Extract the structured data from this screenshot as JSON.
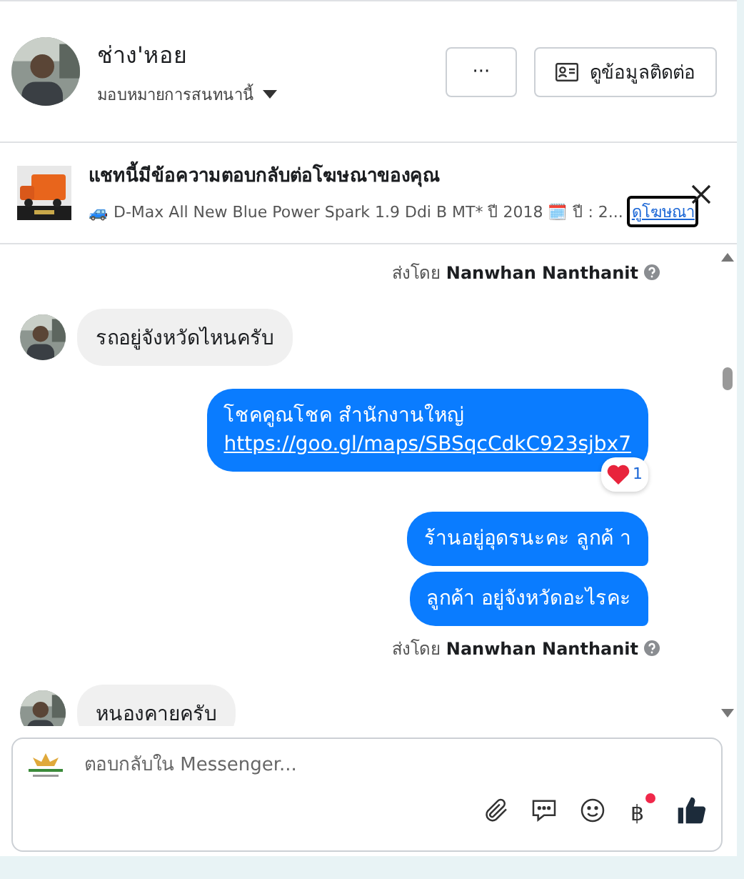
{
  "header": {
    "name": "ช่าง'หอย",
    "assign_label": "มอบหมายการสนทนานี้",
    "more_button": "···",
    "contact_button": "ดูข้อมูลติดต่อ"
  },
  "ad_banner": {
    "title": "แชทนี้มีข้อความตอบกลับต่อโฆษณาของคุณ",
    "description": "🚙 D-Max All New Blue Power Spark 1.9 Ddi B MT* ปี 2018 🗓️ ปี : 2...",
    "link": "ดูโฆษณา"
  },
  "messages": [
    {
      "kind": "sent_by",
      "prefix": "ส่งโดย",
      "sender": "Nanwhan Nanthanit"
    },
    {
      "kind": "incoming",
      "text": "รถอยู่จังหวัดไหนครับ"
    },
    {
      "kind": "outgoing",
      "text": "โชคคูณโชค สำนักงานใหญ่",
      "link": "https://goo.gl/maps/SBSqcCdkC923sjbx7",
      "reaction_count": "1"
    },
    {
      "kind": "outgoing",
      "text": "ร้านอยู่อุดรนะคะ  ลูกค้ า"
    },
    {
      "kind": "outgoing",
      "text": "ลูกค้า  อยู่จังหวัดอะไรคะ"
    },
    {
      "kind": "sent_by",
      "prefix": "ส่งโดย",
      "sender": "Nanwhan Nanthanit"
    },
    {
      "kind": "incoming",
      "text": "หนองคายครับ"
    }
  ],
  "composer": {
    "placeholder": "ตอบกลับใน Messenger...",
    "currency_symbol": "฿",
    "currency_badge": true
  }
}
